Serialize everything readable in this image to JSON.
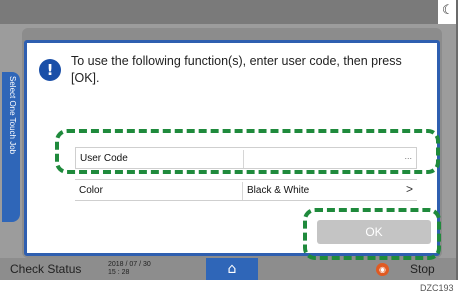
{
  "top_bar": {
    "icon": "moon-icon"
  },
  "side_tab": {
    "label": "Select One Touch Job"
  },
  "dialog": {
    "message": "To use the following function(s), enter user code, then press [OK].",
    "icon": "info-icon",
    "fields": [
      {
        "label": "User Code",
        "value": "",
        "trailing": "..."
      },
      {
        "label": "Color",
        "value": "Black & White",
        "trailing": ">"
      }
    ],
    "ok_label": "OK"
  },
  "bottom_bar": {
    "check_status": "Check Status",
    "date": "2018 / 07 / 30",
    "time": "15 : 28",
    "home_icon": "home-icon",
    "stop_label": "Stop"
  },
  "figure_id": "DZC193"
}
